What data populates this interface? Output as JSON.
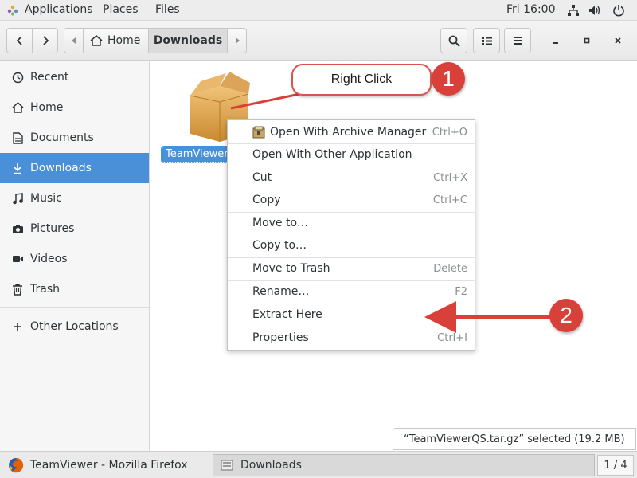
{
  "top_panel": {
    "applications": "Applications",
    "places": "Places",
    "files": "Files",
    "clock": "Fri 16:00",
    "icons": [
      "network-icon",
      "volume-icon",
      "power-icon"
    ]
  },
  "header": {
    "back_icon": "chevron-left-icon",
    "forward_icon": "chevron-right-icon",
    "breadcrumb": {
      "home_label": "Home",
      "current_label": "Downloads"
    },
    "search_icon": "search-icon",
    "view_icon": "list-view-icon",
    "menu_icon": "hamburger-menu-icon",
    "window_controls": {
      "minimize": "_",
      "maximize": "□",
      "close": "×"
    }
  },
  "sidebar": {
    "items": [
      {
        "label": "Recent",
        "icon": "clock-icon"
      },
      {
        "label": "Home",
        "icon": "home-icon"
      },
      {
        "label": "Documents",
        "icon": "document-icon"
      },
      {
        "label": "Downloads",
        "icon": "download-icon",
        "active": true
      },
      {
        "label": "Music",
        "icon": "music-icon"
      },
      {
        "label": "Pictures",
        "icon": "camera-icon"
      },
      {
        "label": "Videos",
        "icon": "video-icon"
      },
      {
        "label": "Trash",
        "icon": "trash-icon"
      }
    ],
    "other_locations": "Other Locations"
  },
  "files": [
    {
      "name": "TeamViewer",
      "icon": "archive-package-icon",
      "selected": true
    }
  ],
  "context_menu": {
    "items": [
      {
        "label": "Open With Archive Manager",
        "accel": "Ctrl+O",
        "icon": "archive-manager-icon"
      },
      {
        "label": "Open With Other Application",
        "accel": ""
      },
      {
        "label": "Cut",
        "accel": "Ctrl+X"
      },
      {
        "label": "Copy",
        "accel": "Ctrl+C"
      },
      {
        "label": "Move to…",
        "accel": ""
      },
      {
        "label": "Copy to…",
        "accel": ""
      },
      {
        "label": "Move to Trash",
        "accel": "Delete"
      },
      {
        "label": "Rename…",
        "accel": "F2"
      },
      {
        "label": "Extract Here",
        "accel": ""
      },
      {
        "label": "Properties",
        "accel": "Ctrl+I"
      }
    ]
  },
  "status": "“TeamViewerQS.tar.gz” selected  (19.2 MB)",
  "taskbar": {
    "tasks": [
      {
        "label": "TeamViewer - Mozilla Firefox",
        "icon": "firefox-icon"
      },
      {
        "label": "Downloads",
        "icon": "file-manager-icon"
      }
    ],
    "workspace": "1 / 4"
  },
  "annotations": {
    "callout_text": "Right Click",
    "badge_1": "1",
    "badge_2": "2",
    "accent_color": "#d9403a"
  },
  "colors": {
    "selection": "#4a90d9",
    "panel": "#ededed"
  }
}
